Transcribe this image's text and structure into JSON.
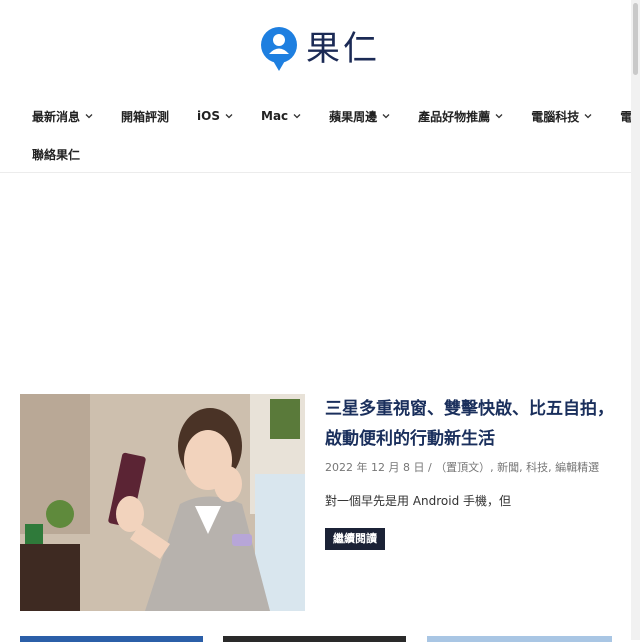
{
  "site": {
    "name": "果仁",
    "logo_icon": "user-bubble-icon",
    "brand_color": "#1e7fe0",
    "title_color": "#1a2f5c"
  },
  "nav": {
    "row1": [
      {
        "label": "最新消息",
        "dropdown": true
      },
      {
        "label": "開箱評測",
        "dropdown": false
      },
      {
        "label": "iOS",
        "dropdown": true
      },
      {
        "label": "Mac",
        "dropdown": true
      },
      {
        "label": "蘋果周邊",
        "dropdown": true
      },
      {
        "label": "產品好物推薦",
        "dropdown": true
      },
      {
        "label": "電腦科技",
        "dropdown": true
      },
      {
        "label": "電動車",
        "dropdown": true
      }
    ],
    "row2": [
      {
        "label": "聯絡果仁",
        "dropdown": false
      }
    ]
  },
  "article": {
    "title": "三星多重視窗、雙擊快啟、比五自拍，啟動便利的行動新生活",
    "date": "2022 年 12 月 8 日",
    "date_sep": " / ",
    "tags": "（置頂文）, 新聞, 科技, 編輯精選",
    "excerpt": "對一個早先是用 Android 手機，但",
    "read_more": "繼續閱讀",
    "image_alt": "woman-taking-selfie-photo"
  }
}
